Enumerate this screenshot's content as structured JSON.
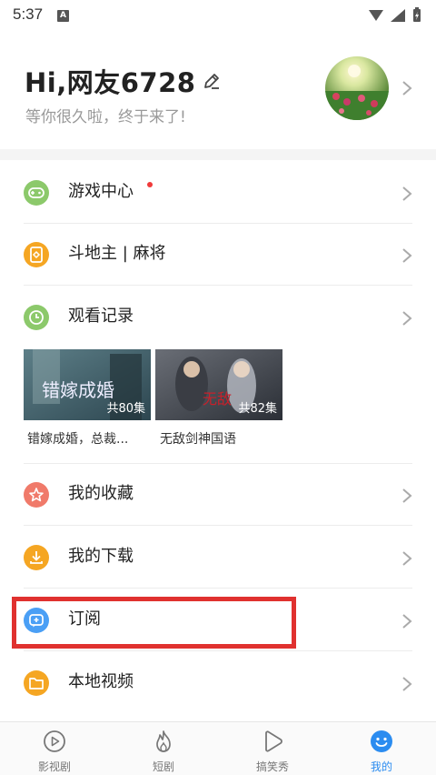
{
  "status_bar": {
    "time": "5:37",
    "notification_badge": "A"
  },
  "profile": {
    "greeting": "Hi,网友6728",
    "subtitle": "等你很久啦，终于来了!"
  },
  "menu": {
    "game_center": "游戏中心",
    "card_games": "斗地主 | 麻将",
    "watch_history": "观看记录",
    "favorites": "我的收藏",
    "downloads": "我的下载",
    "subscribe": "订阅",
    "local_video": "本地视频"
  },
  "history": [
    {
      "title": "错嫁成婚，总裁...",
      "episodes": "共80集",
      "poster_text": "错嫁成婚"
    },
    {
      "title": "无敌剑神国语",
      "episodes": "共82集",
      "poster_text": "无敌"
    }
  ],
  "tabs": [
    {
      "label": "影视剧",
      "icon": "play-icon"
    },
    {
      "label": "短剧",
      "icon": "flame-icon"
    },
    {
      "label": "搞笑秀",
      "icon": "smile-play-icon"
    },
    {
      "label": "我的",
      "icon": "smiley-icon"
    }
  ],
  "colors": {
    "green": "#8cc96b",
    "orange": "#f5a623",
    "red": "#f07a6a",
    "blue": "#4a9ff5",
    "highlight": "#e0312f",
    "tab_active": "#2b8cf0"
  }
}
